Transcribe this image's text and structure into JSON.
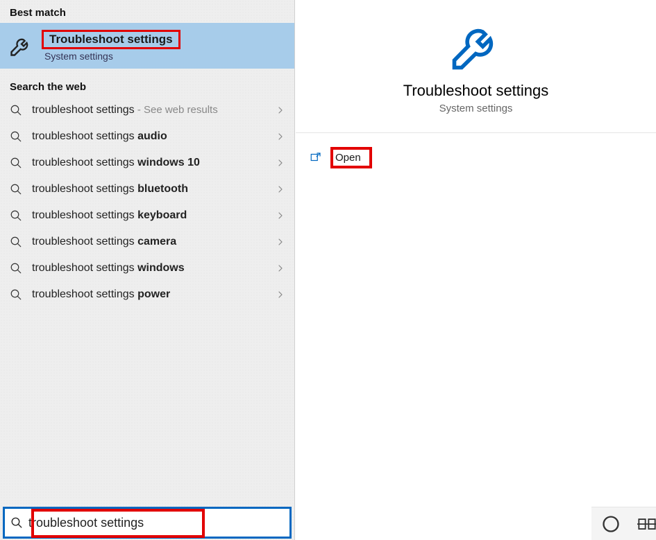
{
  "left": {
    "best_match_header": "Best match",
    "best_match": {
      "title": "Troubleshoot settings",
      "subtitle": "System settings"
    },
    "web_header": "Search the web",
    "web_items": [
      {
        "prefix": "troubleshoot settings",
        "bold": "",
        "suffix": " - See web results"
      },
      {
        "prefix": "troubleshoot settings ",
        "bold": "audio",
        "suffix": ""
      },
      {
        "prefix": "troubleshoot settings ",
        "bold": "windows 10",
        "suffix": ""
      },
      {
        "prefix": "troubleshoot settings ",
        "bold": "bluetooth",
        "suffix": ""
      },
      {
        "prefix": "troubleshoot settings ",
        "bold": "keyboard",
        "suffix": ""
      },
      {
        "prefix": "troubleshoot settings ",
        "bold": "camera",
        "suffix": ""
      },
      {
        "prefix": "troubleshoot settings ",
        "bold": "windows",
        "suffix": ""
      },
      {
        "prefix": "troubleshoot settings ",
        "bold": "power",
        "suffix": ""
      }
    ],
    "search_value": "troubleshoot settings"
  },
  "right": {
    "title": "Troubleshoot settings",
    "subtitle": "System settings",
    "open_label": "Open"
  },
  "taskbar": {
    "items": [
      "cortana",
      "task-view",
      "chrome",
      "file-explorer",
      "word"
    ]
  },
  "colors": {
    "accent": "#0067c0",
    "highlight_red": "#e20000",
    "selection": "#a7ccea"
  }
}
